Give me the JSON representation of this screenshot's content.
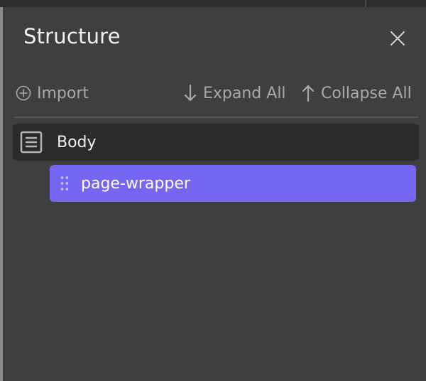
{
  "panel": {
    "title": "Structure",
    "close_icon": "close-icon"
  },
  "toolbar": {
    "import_label": "Import",
    "expand_label": "Expand All",
    "collapse_label": "Collapse All"
  },
  "tree": {
    "items": [
      {
        "label": "Body",
        "icon": "body-icon"
      },
      {
        "label": "page-wrapper",
        "icon": "drag-handle-icon"
      }
    ]
  },
  "colors": {
    "background": "#3f3f3f",
    "row_body": "#2b2b2b",
    "selected_accent": "#7667f3",
    "muted_text": "#a9a9a9",
    "bright_text": "#f1f1f1"
  }
}
